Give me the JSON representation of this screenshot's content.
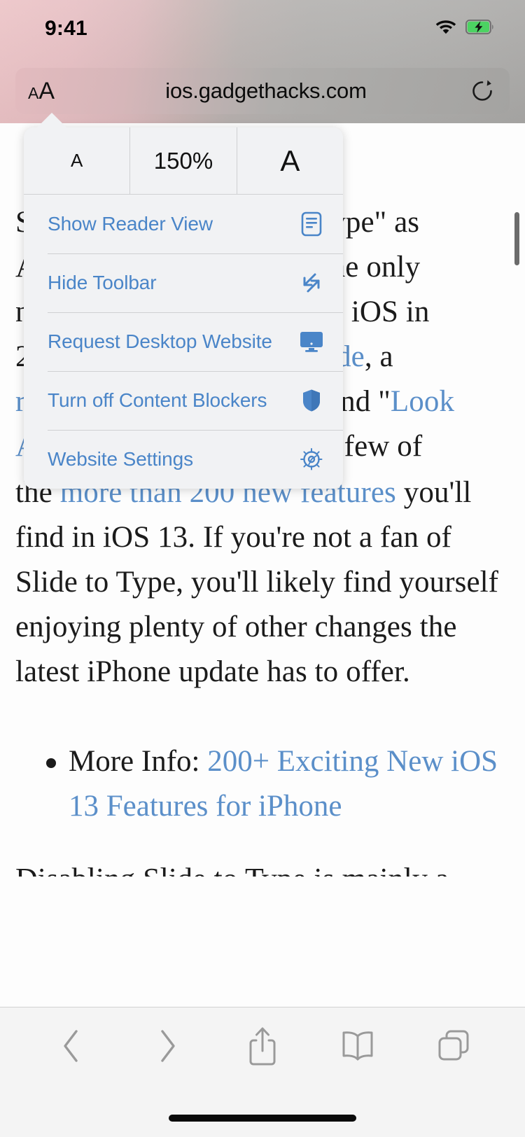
{
  "status_bar": {
    "time": "9:41",
    "wifi_icon": "wifi-icon",
    "battery_icon": "battery-charging-icon",
    "battery_color": "#4cd362"
  },
  "address_bar": {
    "text_size_button": {
      "small_a": "A",
      "big_a": "A",
      "icon": "aa-text-size-icon"
    },
    "lock_icon": "lock-icon",
    "url": "ios.gadgethacks.com",
    "reload_icon": "reload-icon"
  },
  "popup": {
    "zoom": {
      "decrease_label": "A",
      "level": "150%",
      "increase_label": "A"
    },
    "items": [
      {
        "label": "Show Reader View",
        "icon": "reader-view-icon"
      },
      {
        "label": "Hide Toolbar",
        "icon": "hide-toolbar-arrows-icon"
      },
      {
        "label": "Request Desktop Website",
        "icon": "desktop-monitor-icon"
      },
      {
        "label": "Turn off Content Blockers",
        "icon": "shield-icon"
      },
      {
        "label": "Website Settings",
        "icon": "gear-icon"
      }
    ],
    "accent_color": "#4a85c8",
    "background_color": "#f1f2f4"
  },
  "article": {
    "paragraph_1_pre": "S",
    "paragraph_1": {
      "line_1_left": "S",
      "line_1_right": "Type\" as",
      "line_2_left": "A",
      "line_2_right": "the only",
      "line_3_left": "n",
      "line_3_right": " to iOS in",
      "line_4_left": "2",
      "line_4_right_link": "ode",
      "line_4_right": ", a",
      "line_5_left": "r",
      "line_5_right": ", and \"",
      "line_5_right_link": "Look",
      "line_6_left": "A",
      "line_6_right": "a few of"
    },
    "paragraph_2_prefix": "the ",
    "paragraph_2_link": "more than 200 new features",
    "paragraph_2_rest": " you'll find in iOS 13. If you're not a fan of Slide to Type, you'll likely find yourself enjoying plenty of other changes the latest iPhone update has to offer.",
    "bullet": {
      "prefix": "More Info: ",
      "link": "200+ Exciting New iOS 13 Features for iPhone"
    },
    "next_heading_clipped": "Disabling Slide to Type is mainly a",
    "link_color": "#5b8fc9",
    "text_color": "#1b1b1b"
  },
  "toolbar": {
    "buttons": [
      {
        "name": "back-button",
        "icon": "chevron-left-icon"
      },
      {
        "name": "forward-button",
        "icon": "chevron-right-icon"
      },
      {
        "name": "share-button",
        "icon": "share-icon"
      },
      {
        "name": "bookmarks-button",
        "icon": "book-icon"
      },
      {
        "name": "tabs-button",
        "icon": "tabs-icon"
      }
    ]
  }
}
